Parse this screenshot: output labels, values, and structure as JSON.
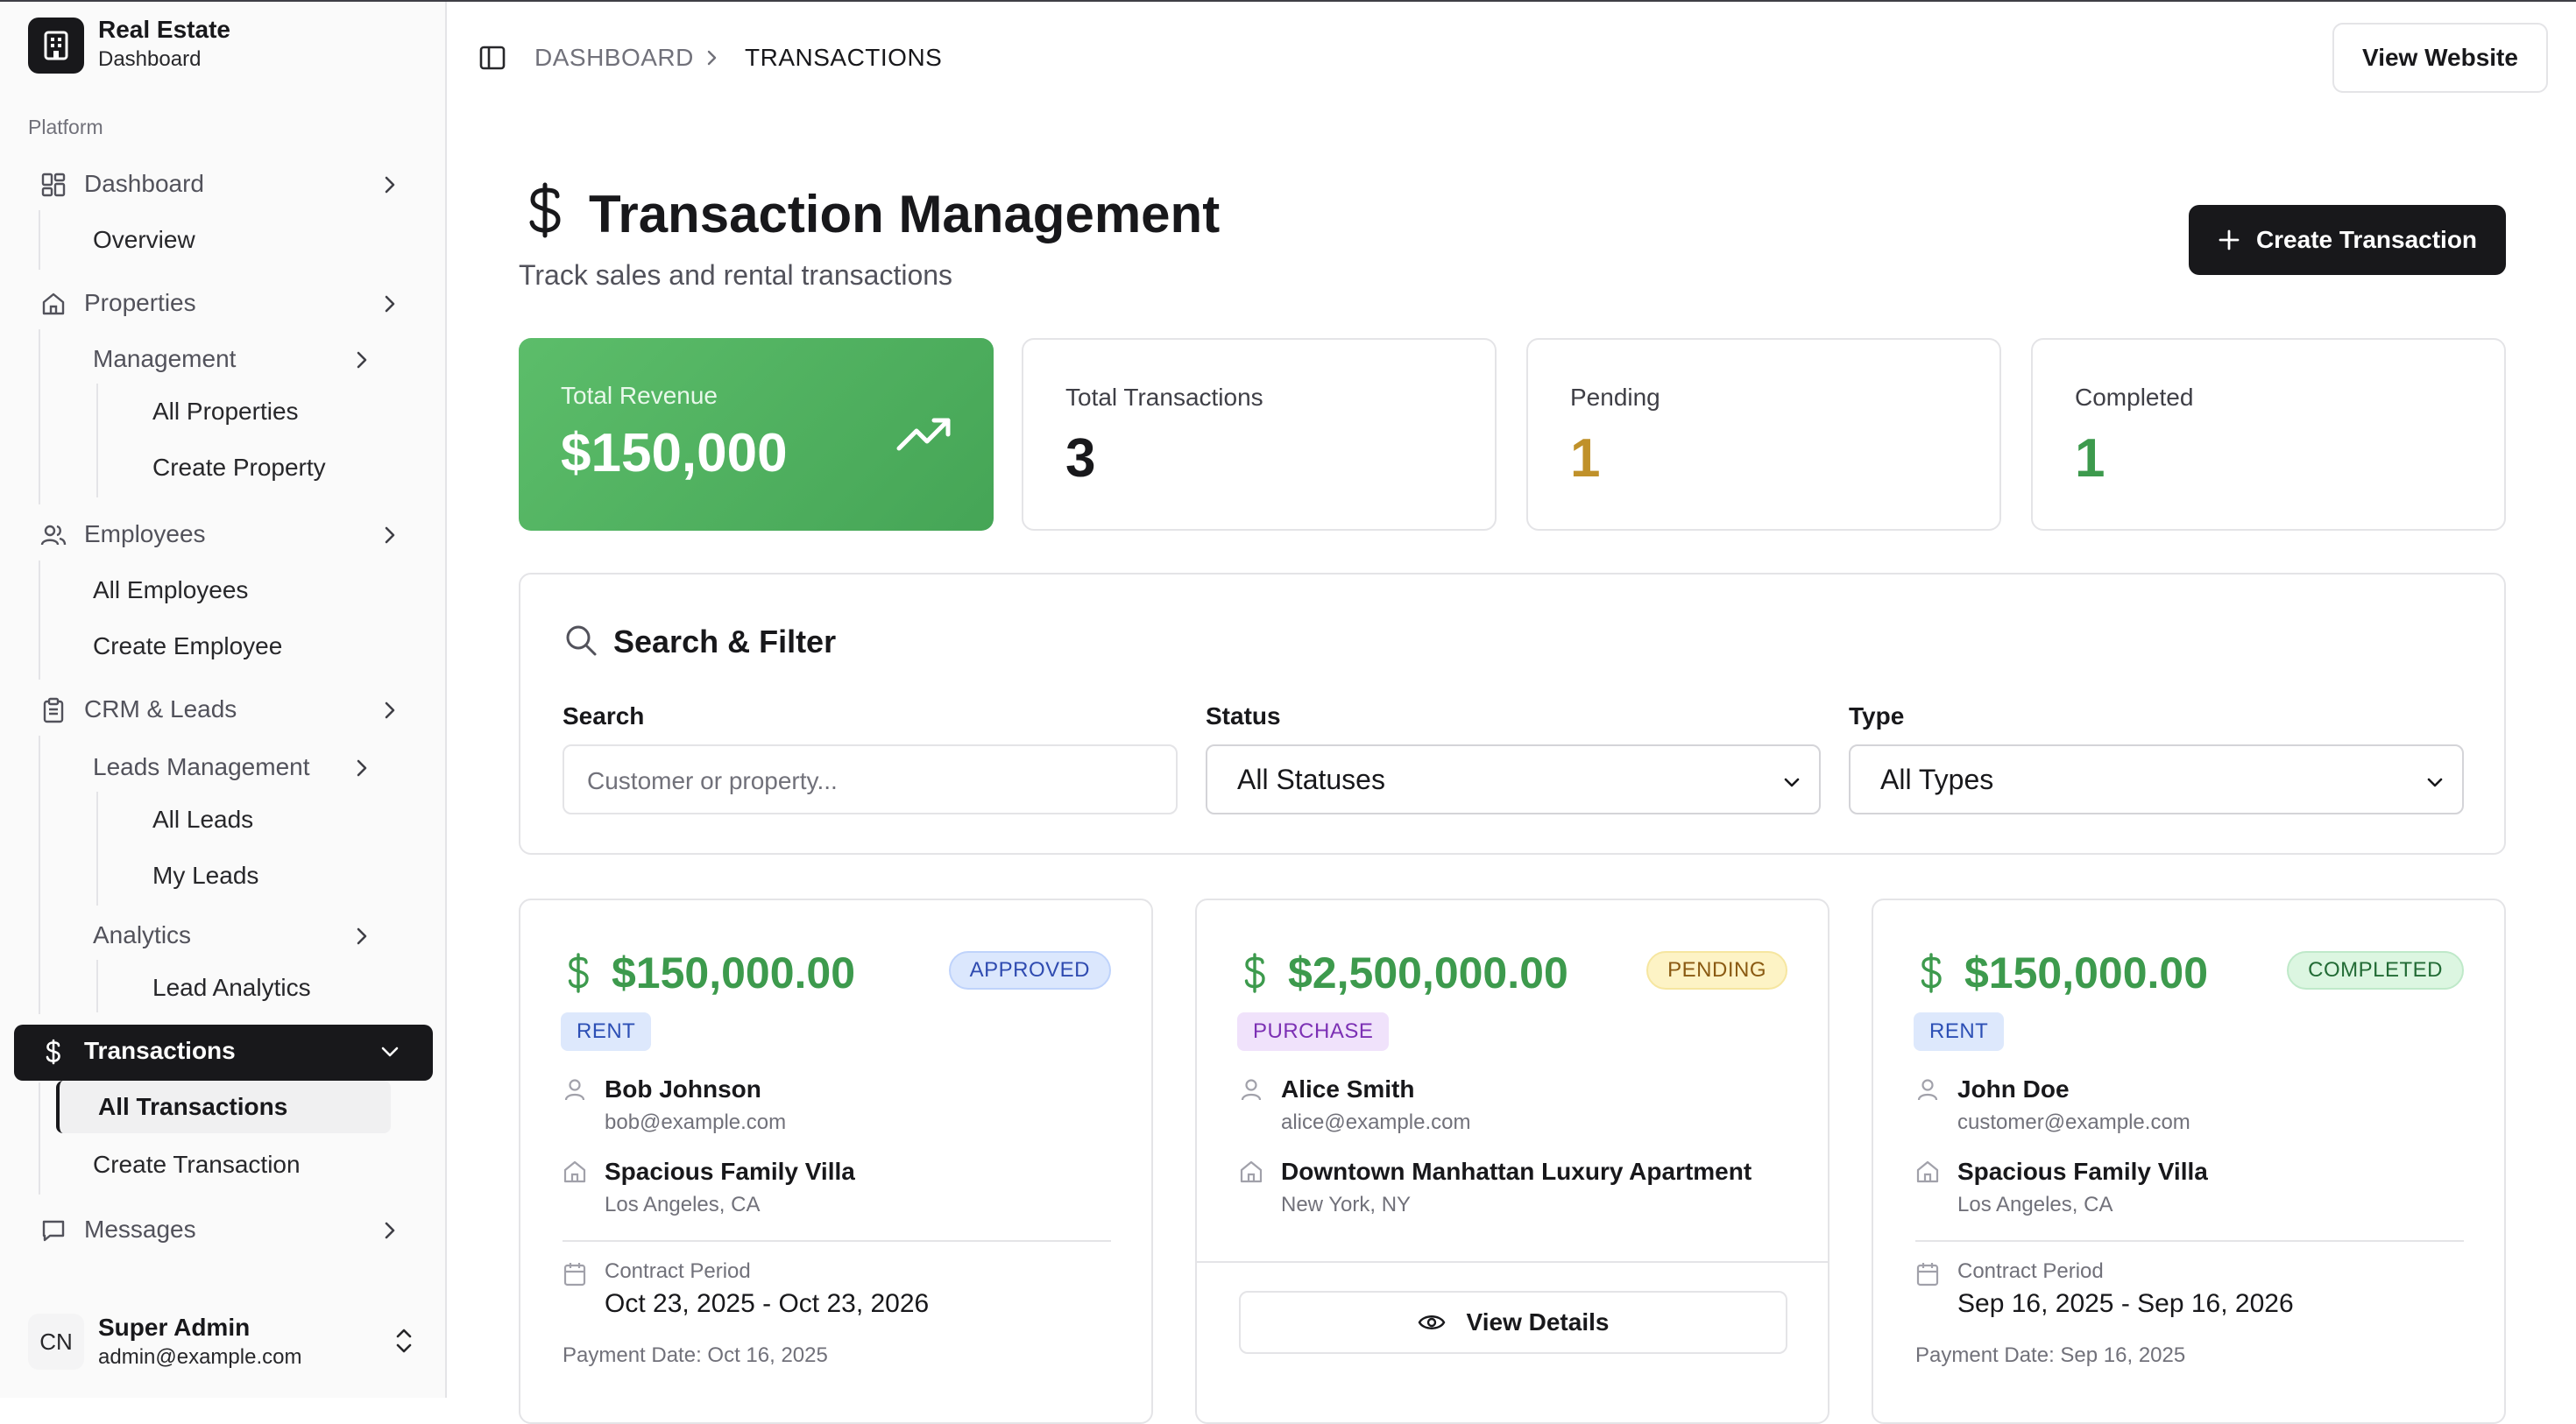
{
  "brand": {
    "title": "Real Estate",
    "subtitle": "Dashboard"
  },
  "sidebar": {
    "section_label": "Platform",
    "dashboard": {
      "label": "Dashboard",
      "children": [
        "Overview"
      ]
    },
    "properties": {
      "label": "Properties",
      "management": "Management",
      "children": [
        "All Properties",
        "Create Property"
      ]
    },
    "employees": {
      "label": "Employees",
      "children": [
        "All Employees",
        "Create Employee"
      ]
    },
    "crm": {
      "label": "CRM & Leads",
      "leads_management": "Leads Management",
      "leads_children": [
        "All Leads",
        "My Leads"
      ],
      "analytics": "Analytics",
      "analytics_children": [
        "Lead Analytics"
      ]
    },
    "transactions": {
      "label": "Transactions",
      "children": [
        "All Transactions",
        "Create Transaction"
      ]
    },
    "messages": {
      "label": "Messages"
    }
  },
  "user": {
    "initials": "CN",
    "name": "Super Admin",
    "email": "admin@example.com"
  },
  "header": {
    "breadcrumb": [
      "DASHBOARD",
      "TRANSACTIONS"
    ],
    "view_website": "View Website"
  },
  "page": {
    "title": "Transaction Management",
    "subtitle": "Track sales and rental transactions",
    "create_button": "Create Transaction"
  },
  "stats": [
    {
      "label": "Total Revenue",
      "value": "$150,000"
    },
    {
      "label": "Total Transactions",
      "value": "3"
    },
    {
      "label": "Pending",
      "value": "1"
    },
    {
      "label": "Completed",
      "value": "1"
    }
  ],
  "filters": {
    "title": "Search & Filter",
    "search_label": "Search",
    "search_placeholder": "Customer or property...",
    "status_label": "Status",
    "status_value": "All Statuses",
    "type_label": "Type",
    "type_value": "All Types"
  },
  "transactions": [
    {
      "amount": "$150,000.00",
      "status": "APPROVED",
      "type": "RENT",
      "customer": "Bob Johnson",
      "email": "bob@example.com",
      "property": "Spacious Family Villa",
      "location": "Los Angeles, CA",
      "contract_label": "Contract Period",
      "contract_period": "Oct 23, 2025 - Oct 23, 2026",
      "payment_date": "Payment Date: Oct 16, 2025"
    },
    {
      "amount": "$2,500,000.00",
      "status": "PENDING",
      "type": "PURCHASE",
      "customer": "Alice Smith",
      "email": "alice@example.com",
      "property": "Downtown Manhattan Luxury Apartment",
      "location": "New York, NY",
      "action": "View Details"
    },
    {
      "amount": "$150,000.00",
      "status": "COMPLETED",
      "type": "RENT",
      "customer": "John Doe",
      "email": "customer@example.com",
      "property": "Spacious Family Villa",
      "location": "Los Angeles, CA",
      "contract_label": "Contract Period",
      "contract_period": "Sep 16, 2025 - Sep 16, 2026",
      "payment_date": "Payment Date: Sep 16, 2025"
    }
  ],
  "colors": {
    "accent_green": "#3d9a4d",
    "pending_amber": "#c0912a",
    "sidebar_active": "#18181b"
  }
}
